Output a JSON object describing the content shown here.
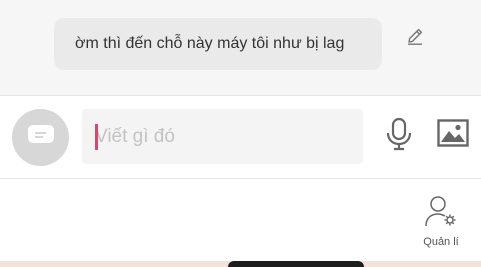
{
  "message": {
    "text": "ờm thì đến chỗ này máy tôi như bị lag",
    "edit_icon": "pencil-icon"
  },
  "composer": {
    "sticker_icon": "chat-bubble-icon",
    "input_placeholder": "Viết gì đó",
    "input_value": "",
    "mic_icon": "microphone-icon",
    "image_icon": "image-icon",
    "caret_color": "#d24a6c"
  },
  "toolbar": {
    "manage_label": "Quản lí",
    "manage_icon": "user-settings-icon"
  }
}
